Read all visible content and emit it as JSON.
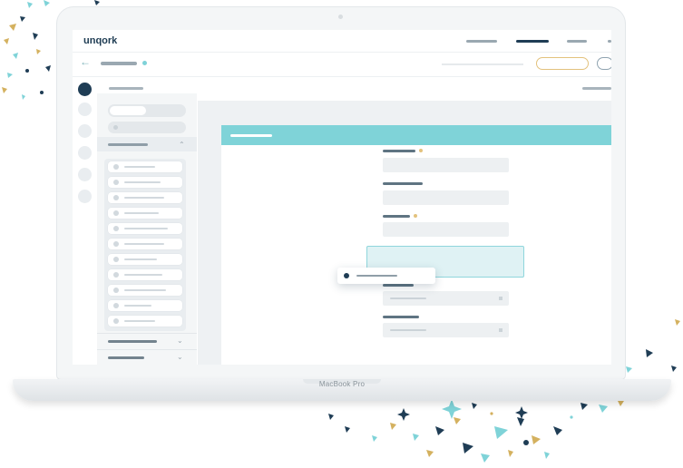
{
  "app": {
    "logo_text": "unqork",
    "device_label": "MacBook Pro"
  },
  "colors": {
    "brand_navy": "#1d3b52",
    "accent_teal": "#7fd3d8",
    "accent_gold": "#e3c27d",
    "panel_gray": "#f4f6f7"
  },
  "icons": {
    "back": "←",
    "chevron_up": "⌃",
    "chevron_down": "⌄"
  }
}
